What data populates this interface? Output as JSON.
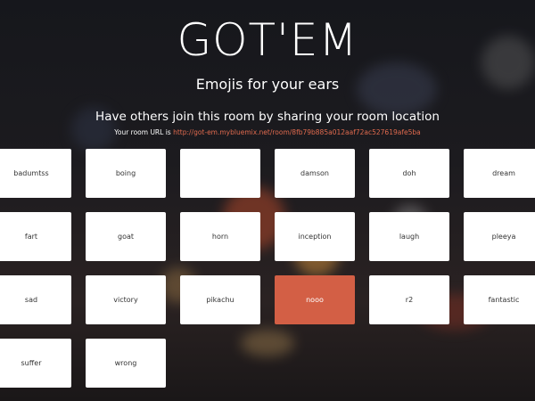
{
  "header": {
    "title": "GOT'EM",
    "subtitle": "Emojis for your ears",
    "share_heading": "Have others join this room by sharing your room location",
    "room_url_prefix": "Your room URL is",
    "room_url": "http://got-em.mybluemix.net/room/8fb79b885a012aaf72ac527619afe5ba"
  },
  "sounds": [
    {
      "label": "badumtss",
      "active": false
    },
    {
      "label": "boing",
      "active": false
    },
    {
      "label": "",
      "active": false
    },
    {
      "label": "damson",
      "active": false
    },
    {
      "label": "doh",
      "active": false
    },
    {
      "label": "dream",
      "active": false
    },
    {
      "label": "fart",
      "active": false
    },
    {
      "label": "goat",
      "active": false
    },
    {
      "label": "horn",
      "active": false
    },
    {
      "label": "inception",
      "active": false
    },
    {
      "label": "laugh",
      "active": false
    },
    {
      "label": "pleeya",
      "active": false
    },
    {
      "label": "sad",
      "active": false
    },
    {
      "label": "victory",
      "active": false
    },
    {
      "label": "pikachu",
      "active": false
    },
    {
      "label": "nooo",
      "active": true
    },
    {
      "label": "r2",
      "active": false
    },
    {
      "label": "fantastic",
      "active": false
    },
    {
      "label": "suffer",
      "active": false
    },
    {
      "label": "wrong",
      "active": false
    }
  ],
  "colors": {
    "accent": "#d35f45",
    "link": "#e06a4e",
    "tile": "#ffffff"
  }
}
